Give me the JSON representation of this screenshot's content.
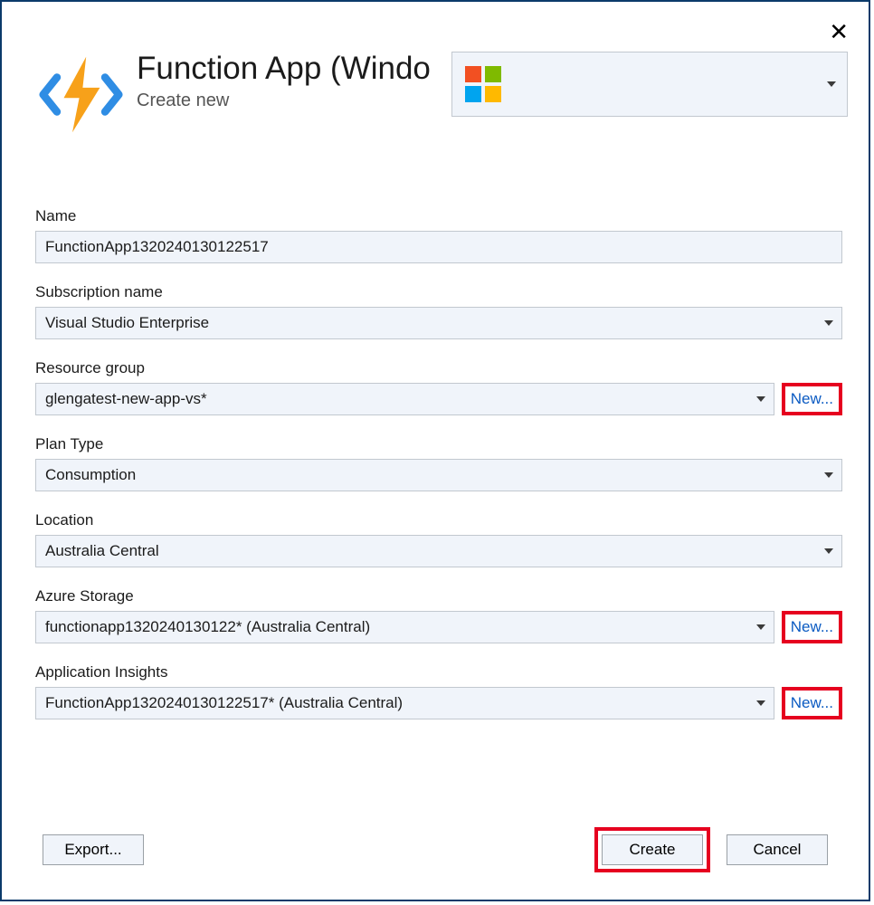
{
  "header": {
    "title": "Function App (Windo",
    "subtitle": "Create new"
  },
  "fields": {
    "name": {
      "label": "Name",
      "value": "FunctionApp1320240130122517"
    },
    "subscription": {
      "label": "Subscription name",
      "value": "Visual Studio Enterprise"
    },
    "resource_group": {
      "label": "Resource group",
      "value": "glengatest-new-app-vs*",
      "new_label": "New..."
    },
    "plan_type": {
      "label": "Plan Type",
      "value": "Consumption"
    },
    "location": {
      "label": "Location",
      "value": "Australia Central"
    },
    "storage": {
      "label": "Azure Storage",
      "value": "functionapp1320240130122* (Australia Central)",
      "new_label": "New..."
    },
    "app_insights": {
      "label": "Application Insights",
      "value": "FunctionApp1320240130122517* (Australia Central)",
      "new_label": "New..."
    }
  },
  "buttons": {
    "export": "Export...",
    "create": "Create",
    "cancel": "Cancel"
  }
}
